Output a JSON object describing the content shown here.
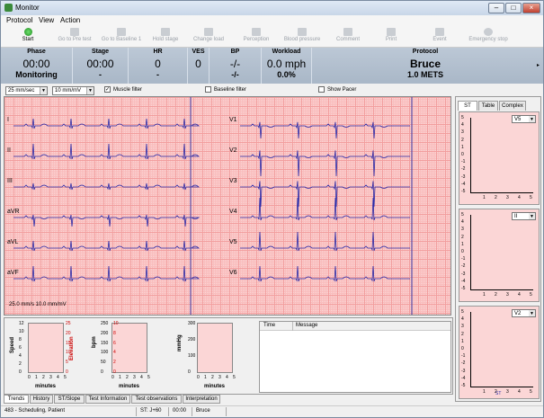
{
  "window": {
    "title": "Monitor"
  },
  "menu": [
    "Protocol",
    "View",
    "Action"
  ],
  "toolbar": [
    "Start",
    "Go to Pre test",
    "Go to Baseline 1",
    "Hold stage",
    "Change load",
    "Perception",
    "Blood pressure",
    "Comment",
    "Print",
    "Event",
    "Emergency stop"
  ],
  "status": {
    "phase": {
      "label": "Phase",
      "value": "00:00",
      "sub": "Monitoring"
    },
    "stage": {
      "label": "Stage",
      "value": "00:00",
      "sub": "-"
    },
    "hr": {
      "label": "HR",
      "value": "0",
      "sub": "-"
    },
    "ves": {
      "label": "VES",
      "value": "0"
    },
    "bp": {
      "label": "BP",
      "value": "-/-",
      "sub": "-/-"
    },
    "workload": {
      "label": "Workload",
      "value": "0.0 mph",
      "sub": "0.0%"
    },
    "protocol": {
      "label": "Protocol",
      "value": "Bruce",
      "sub": "1.0 METS"
    }
  },
  "controls": {
    "speed": "25 mm/sec",
    "gain": "10 mm/mV",
    "muscle_filter": "Muscle filter",
    "baseline_filter": "Baseline filter",
    "show_pacer": "Show Pacer"
  },
  "leads_left": [
    "I",
    "II",
    "III",
    "aVR",
    "aVL",
    "aVF"
  ],
  "leads_right": [
    "V1",
    "V2",
    "V3",
    "V4",
    "V5",
    "V6"
  ],
  "ecg_note": "25.0 mm/s 10.0 mm/mV",
  "right_tabs": [
    "ST",
    "Table",
    "Complex"
  ],
  "st_plots": [
    {
      "lead": "V5",
      "y_ticks": [
        "5",
        "4",
        "3",
        "2",
        "1",
        "0",
        "-1",
        "-2",
        "-3",
        "-4",
        "-5"
      ],
      "x_ticks": [
        "1",
        "2",
        "3",
        "4",
        "5"
      ]
    },
    {
      "lead": "II",
      "y_ticks": [
        "5",
        "4",
        "3",
        "2",
        "1",
        "0",
        "-1",
        "-2",
        "-3",
        "-4",
        "-5"
      ],
      "x_ticks": [
        "1",
        "2",
        "3",
        "4",
        "5"
      ]
    },
    {
      "lead": "V2",
      "y_ticks": [
        "5",
        "4",
        "3",
        "2",
        "1",
        "0",
        "-1",
        "-2",
        "-3",
        "-4",
        "-5"
      ],
      "x_ticks": [
        "1",
        "2",
        "3",
        "4",
        "5"
      ],
      "footer": "ST"
    }
  ],
  "trends": {
    "speed": {
      "label": "Speed",
      "elevation_label": "Elevation",
      "x_label": "minutes",
      "x_ticks": [
        "0",
        "1",
        "2",
        "3",
        "4",
        "5"
      ],
      "y_left": [
        "12",
        "10",
        "8",
        "6",
        "4",
        "2",
        "0"
      ],
      "y_right": [
        "25",
        "20",
        "15",
        "10",
        "5",
        "0"
      ]
    },
    "bpm": {
      "label": "bpm",
      "x_label": "minutes",
      "x_ticks": [
        "0",
        "1",
        "2",
        "3",
        "4",
        "5"
      ],
      "y_left": [
        "250",
        "200",
        "150",
        "100",
        "50",
        "0"
      ],
      "y_right": [
        "10",
        "8",
        "6",
        "4",
        "2",
        "0"
      ]
    },
    "mmhg": {
      "label": "mmHg",
      "x_label": "minutes",
      "x_ticks": [
        "0",
        "1",
        "2",
        "3",
        "4",
        "5"
      ],
      "y_left": [
        "300",
        "200",
        "100",
        "0"
      ]
    }
  },
  "messages": {
    "col_time": "Time",
    "col_message": "Message"
  },
  "bottom_tabs": [
    "Trends",
    "History",
    "ST/Slope",
    "Test Information",
    "Test observations",
    "Interpretation"
  ],
  "statusbar": {
    "patient": "483 - Scheduling, Patient",
    "st": "ST: J+60",
    "time": "00:00",
    "protocol": "Bruce"
  }
}
